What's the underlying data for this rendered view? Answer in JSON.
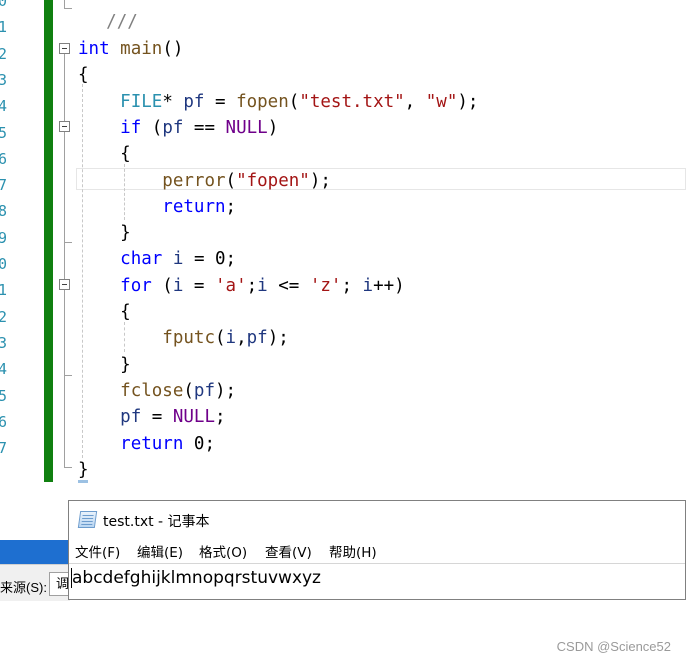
{
  "editor": {
    "top_fragment": "///",
    "line_numbers": [
      "0",
      "1",
      "2",
      "3",
      "4",
      "5",
      "6",
      "7",
      "8",
      "9",
      "0",
      "1",
      "2",
      "3",
      "4",
      "5",
      "6",
      "7"
    ],
    "lines": [
      {
        "segments": [
          {
            "t": "int",
            "c": "kw"
          },
          {
            "t": " ",
            "c": ""
          },
          {
            "t": "main",
            "c": "fn"
          },
          {
            "t": "()",
            "c": ""
          }
        ]
      },
      {
        "segments": [
          {
            "t": "{",
            "c": ""
          }
        ]
      },
      {
        "segments": [
          {
            "t": "    ",
            "c": ""
          },
          {
            "t": "FILE",
            "c": "tp"
          },
          {
            "t": "* ",
            "c": ""
          },
          {
            "t": "pf",
            "c": "var"
          },
          {
            "t": " = ",
            "c": ""
          },
          {
            "t": "fopen",
            "c": "fn"
          },
          {
            "t": "(",
            "c": ""
          },
          {
            "t": "\"test.txt\"",
            "c": "str"
          },
          {
            "t": ", ",
            "c": ""
          },
          {
            "t": "\"w\"",
            "c": "str"
          },
          {
            "t": ");",
            "c": ""
          }
        ]
      },
      {
        "segments": [
          {
            "t": "    ",
            "c": ""
          },
          {
            "t": "if",
            "c": "kw"
          },
          {
            "t": " (",
            "c": ""
          },
          {
            "t": "pf",
            "c": "var"
          },
          {
            "t": " == ",
            "c": ""
          },
          {
            "t": "NULL",
            "c": "mac"
          },
          {
            "t": ")",
            "c": ""
          }
        ]
      },
      {
        "segments": [
          {
            "t": "    {",
            "c": ""
          }
        ]
      },
      {
        "segments": [
          {
            "t": "        ",
            "c": ""
          },
          {
            "t": "perror",
            "c": "fn"
          },
          {
            "t": "(",
            "c": ""
          },
          {
            "t": "\"fopen\"",
            "c": "str"
          },
          {
            "t": ");",
            "c": ""
          }
        ]
      },
      {
        "segments": [
          {
            "t": "        ",
            "c": ""
          },
          {
            "t": "return",
            "c": "kw"
          },
          {
            "t": ";",
            "c": ""
          }
        ]
      },
      {
        "segments": [
          {
            "t": "    }",
            "c": ""
          }
        ]
      },
      {
        "segments": [
          {
            "t": "    ",
            "c": ""
          },
          {
            "t": "char",
            "c": "kw"
          },
          {
            "t": " ",
            "c": ""
          },
          {
            "t": "i",
            "c": "var"
          },
          {
            "t": " = 0;",
            "c": ""
          }
        ]
      },
      {
        "segments": [
          {
            "t": "    ",
            "c": ""
          },
          {
            "t": "for",
            "c": "kw"
          },
          {
            "t": " (",
            "c": ""
          },
          {
            "t": "i",
            "c": "var"
          },
          {
            "t": " = ",
            "c": ""
          },
          {
            "t": "'a'",
            "c": "str"
          },
          {
            "t": ";",
            "c": ""
          },
          {
            "t": "i",
            "c": "var"
          },
          {
            "t": " <= ",
            "c": ""
          },
          {
            "t": "'z'",
            "c": "str"
          },
          {
            "t": "; ",
            "c": ""
          },
          {
            "t": "i",
            "c": "var"
          },
          {
            "t": "++)",
            "c": ""
          }
        ]
      },
      {
        "segments": [
          {
            "t": "    {",
            "c": ""
          }
        ]
      },
      {
        "segments": [
          {
            "t": "        ",
            "c": ""
          },
          {
            "t": "fputc",
            "c": "fn"
          },
          {
            "t": "(",
            "c": ""
          },
          {
            "t": "i",
            "c": "var"
          },
          {
            "t": ",",
            "c": ""
          },
          {
            "t": "pf",
            "c": "var"
          },
          {
            "t": ");",
            "c": ""
          }
        ]
      },
      {
        "segments": [
          {
            "t": "    }",
            "c": ""
          }
        ]
      },
      {
        "segments": [
          {
            "t": "    ",
            "c": ""
          },
          {
            "t": "fclose",
            "c": "fn"
          },
          {
            "t": "(",
            "c": ""
          },
          {
            "t": "pf",
            "c": "var"
          },
          {
            "t": ");",
            "c": ""
          }
        ]
      },
      {
        "segments": [
          {
            "t": "    ",
            "c": ""
          },
          {
            "t": "pf",
            "c": "var"
          },
          {
            "t": " = ",
            "c": ""
          },
          {
            "t": "NULL",
            "c": "mac"
          },
          {
            "t": ";",
            "c": ""
          }
        ]
      },
      {
        "segments": [
          {
            "t": "    ",
            "c": ""
          },
          {
            "t": "return",
            "c": "kw"
          },
          {
            "t": " 0;",
            "c": ""
          }
        ]
      },
      {
        "segments": [
          {
            "t": "}",
            "c": ""
          }
        ]
      }
    ],
    "colors": {
      "keyword": "#0000ff",
      "type": "#2b91af",
      "macro": "#6f008a",
      "string": "#a31515",
      "function": "#74531f",
      "variable": "#1f377f",
      "change_bar": "#108010"
    }
  },
  "status": {
    "source_label": "来源(S):",
    "box_text": "调"
  },
  "notepad": {
    "icon": "notepad-icon",
    "title": "test.txt - 记事本",
    "menus": [
      "文件(F)",
      "编辑(E)",
      "格式(O)",
      "查看(V)",
      "帮助(H)"
    ],
    "content": "abcdefghijklmnopqrstuvwxyz"
  },
  "watermark": "CSDN @Science52"
}
